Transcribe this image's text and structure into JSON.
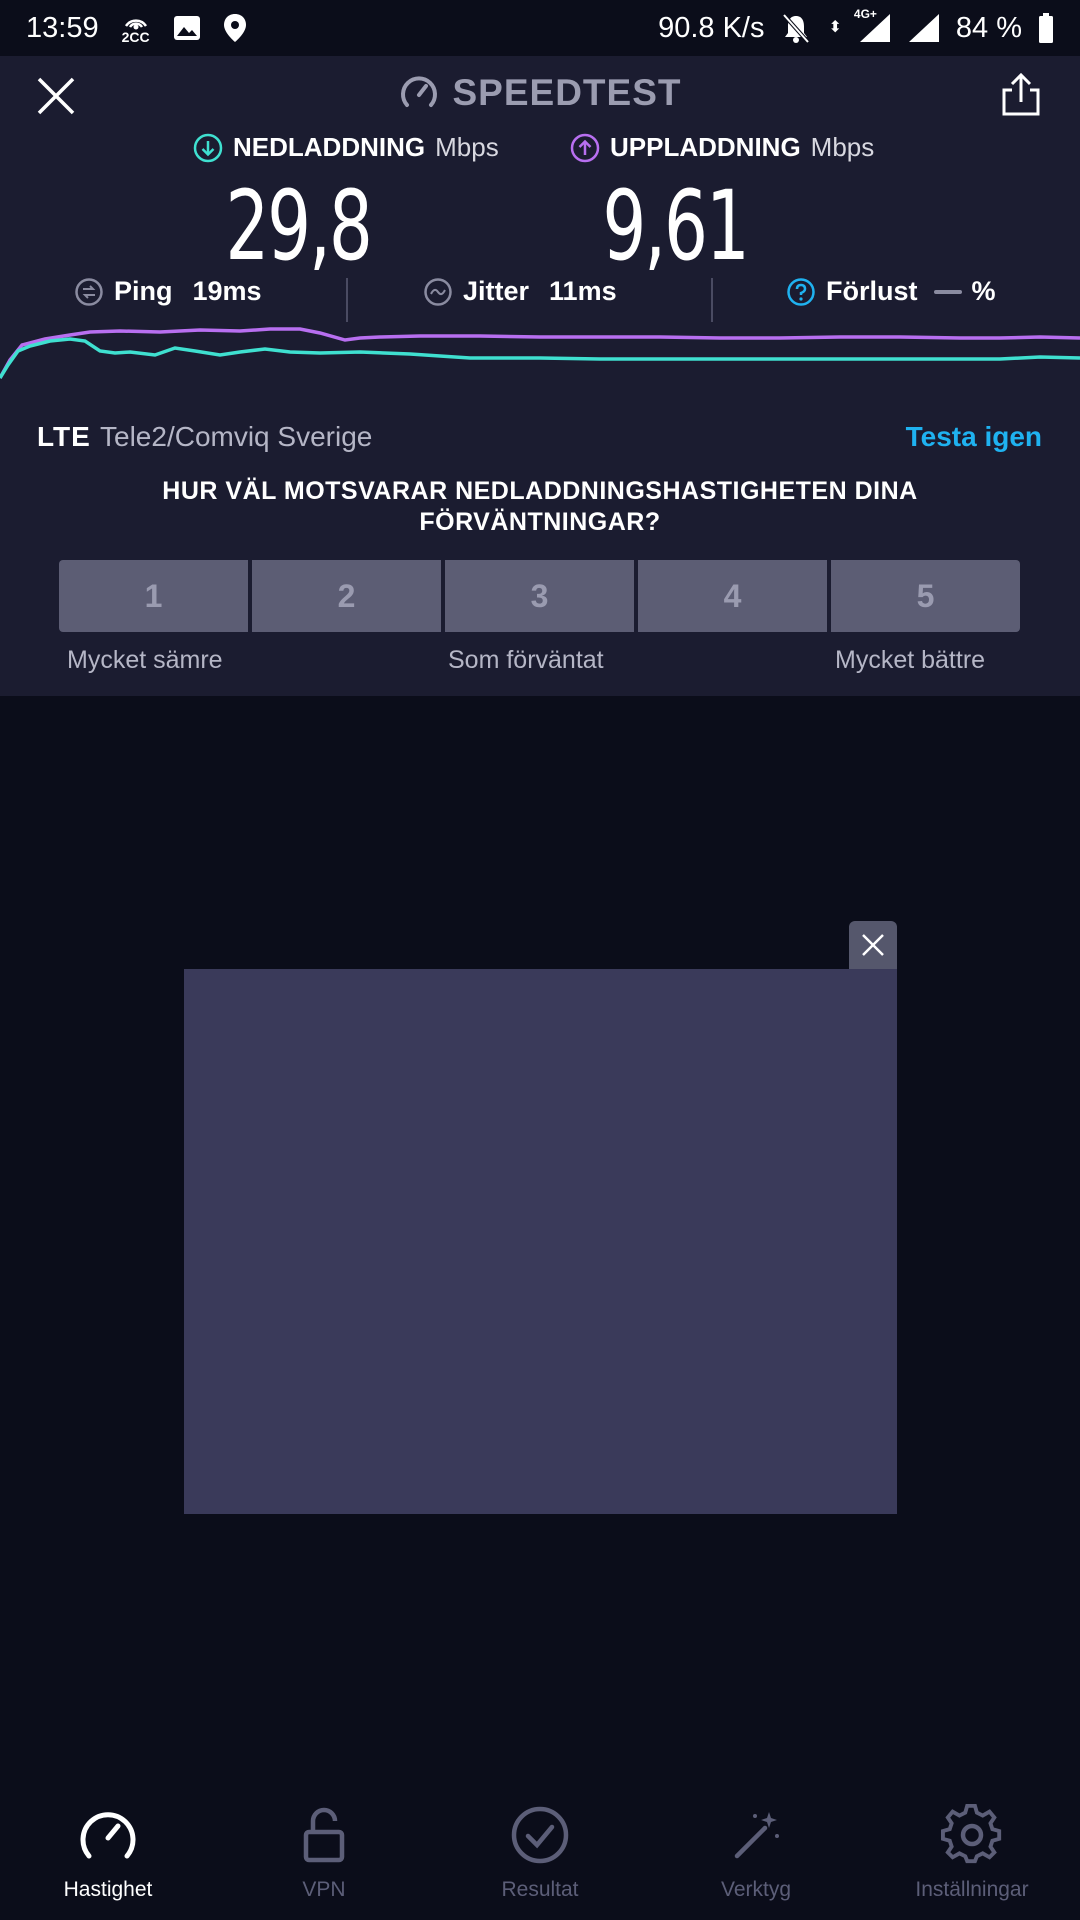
{
  "status_bar": {
    "time": "13:59",
    "hotspot_label": "2CC",
    "net_speed": "90.8 K/s",
    "network_badge": "4G+",
    "battery": "84 %"
  },
  "header": {
    "title": "SPEEDTEST",
    "icons": {
      "close": "close-icon",
      "share": "share-icon",
      "title": "speedometer-icon"
    }
  },
  "metrics": {
    "download": {
      "label": "NEDLADDNING",
      "unit": "Mbps",
      "value": "29,8",
      "color": "#3fe0d0"
    },
    "upload": {
      "label": "UPPLADDNING",
      "unit": "Mbps",
      "value": "9,61",
      "color": "#b86ff0"
    }
  },
  "stats": {
    "ping": {
      "label": "Ping",
      "value": "19ms"
    },
    "jitter": {
      "label": "Jitter",
      "value": "11ms"
    },
    "loss": {
      "label": "Förlust",
      "value": "%"
    }
  },
  "connection": {
    "type": "LTE",
    "provider": "Tele2/Comviq Sverige",
    "retry_label": "Testa igen"
  },
  "survey": {
    "question": "HUR VÄL MOTSVARAR NEDLADDNINGSHASTIGHETEN DINA FÖRVÄNTNINGAR?",
    "options": [
      "1",
      "2",
      "3",
      "4",
      "5"
    ],
    "caption_low": "Mycket sämre",
    "caption_mid": "Som förväntat",
    "caption_high": "Mycket bättre"
  },
  "nav": {
    "items": [
      {
        "label": "Hastighet",
        "icon": "speedometer-icon",
        "active": true
      },
      {
        "label": "VPN",
        "icon": "unlock-icon",
        "active": false
      },
      {
        "label": "Resultat",
        "icon": "check-circle-icon",
        "active": false
      },
      {
        "label": "Verktyg",
        "icon": "magic-wand-icon",
        "active": false
      },
      {
        "label": "Inställningar",
        "icon": "gear-icon",
        "active": false
      }
    ]
  },
  "colors": {
    "accent_blue": "#1fb2f0",
    "panel": "#1b1c30",
    "background": "#0b0d1a"
  }
}
